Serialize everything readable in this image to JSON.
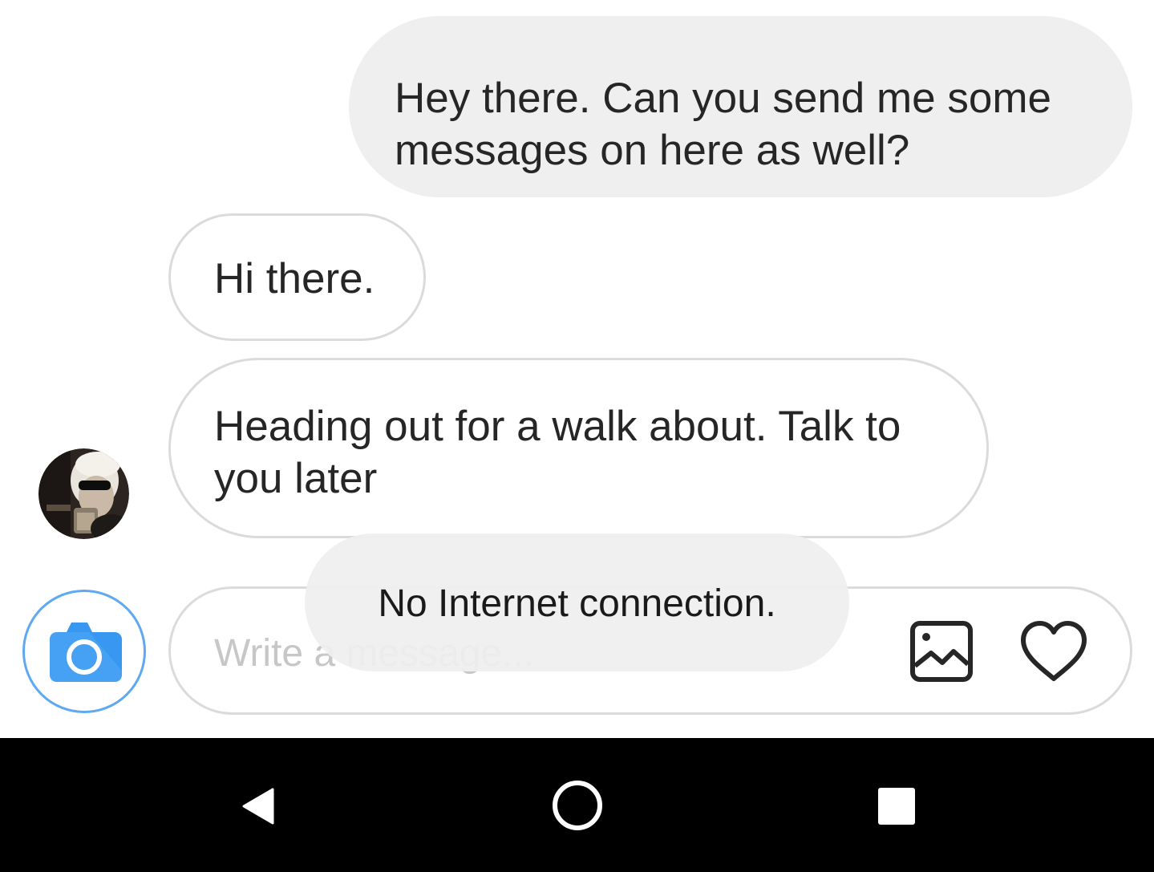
{
  "messages": [
    {
      "direction": "sent",
      "text": "Hey there. Can you send me some messages on here as well?"
    },
    {
      "direction": "received",
      "text": "Hi there."
    },
    {
      "direction": "received",
      "text": "Heading out for a walk about. Talk to you later"
    }
  ],
  "composer": {
    "placeholder": "Write a message...",
    "value": ""
  },
  "toast": {
    "text": "No Internet connection."
  },
  "icons": {
    "camera": "camera-icon",
    "gallery": "image-gallery-icon",
    "like": "heart-icon",
    "back": "nav-back-icon",
    "home": "nav-home-icon",
    "recents": "nav-recents-icon"
  },
  "colors": {
    "sent_bubble": "#efefef",
    "received_border": "#dbdbdb",
    "camera_accent": "#5fa8f2",
    "camera_fill": "#3897f0",
    "nav_bar": "#000000"
  }
}
